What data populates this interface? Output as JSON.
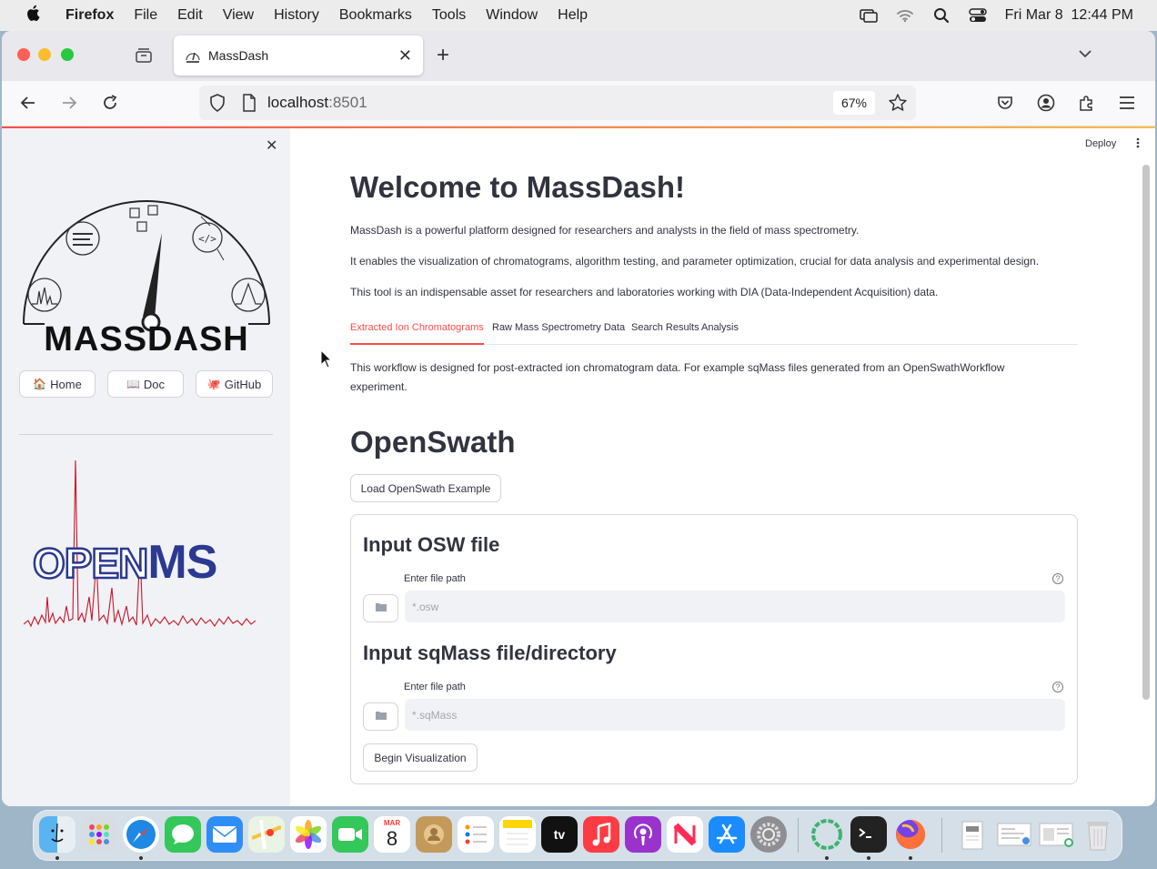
{
  "menubar": {
    "app": "Firefox",
    "items": [
      "File",
      "Edit",
      "View",
      "History",
      "Bookmarks",
      "Tools",
      "Window",
      "Help"
    ],
    "datetime": "Fri Mar 8  12:44 PM"
  },
  "browser": {
    "tab_title": "MassDash",
    "url_host": "localhost",
    "url_port": ":8501",
    "zoom": "67%"
  },
  "sidebar": {
    "logo_text": "MASSDASH",
    "buttons": [
      {
        "icon": "🏠",
        "label": "Home"
      },
      {
        "icon": "📖",
        "label": "Doc"
      },
      {
        "icon": "🐙",
        "label": "GitHub"
      }
    ],
    "openms_logo": {
      "part1": "OPEN",
      "part2": "MS"
    }
  },
  "header": {
    "deploy": "Deploy"
  },
  "main": {
    "title": "Welcome to MassDash!",
    "intro": [
      "MassDash is a powerful platform designed for researchers and analysts in the field of mass spectrometry.",
      "It enables the visualization of chromatograms, algorithm testing, and parameter optimization, crucial for data analysis and experimental design.",
      "This tool is an indispensable asset for researchers and laboratories working with DIA (Data-Independent Acquisition) data."
    ],
    "tabs": [
      {
        "label": "Extracted Ion Chromatograms",
        "active": true
      },
      {
        "label": "Raw Mass Spectrometry Data",
        "active": false
      },
      {
        "label": "Search Results Analysis",
        "active": false
      }
    ],
    "workflow_text_1": "This workflow is designed for post-extracted ion chromatogram data. For example sqMass files generated from an OpenSwathWorkflow",
    "workflow_text_2": "experiment.",
    "section_title": "OpenSwath",
    "load_example_label": "Load OpenSwath Example",
    "osw": {
      "title": "Input OSW file",
      "label": "Enter file path",
      "placeholder": "*.osw"
    },
    "sqmass": {
      "title": "Input sqMass file/directory",
      "label": "Enter file path",
      "placeholder": "*.sqMass"
    },
    "begin_label": "Begin Visualization",
    "help_glyph": "?"
  },
  "dock": {
    "calendar_month": "MAR",
    "calendar_day": "8",
    "tv_label": "tv"
  }
}
